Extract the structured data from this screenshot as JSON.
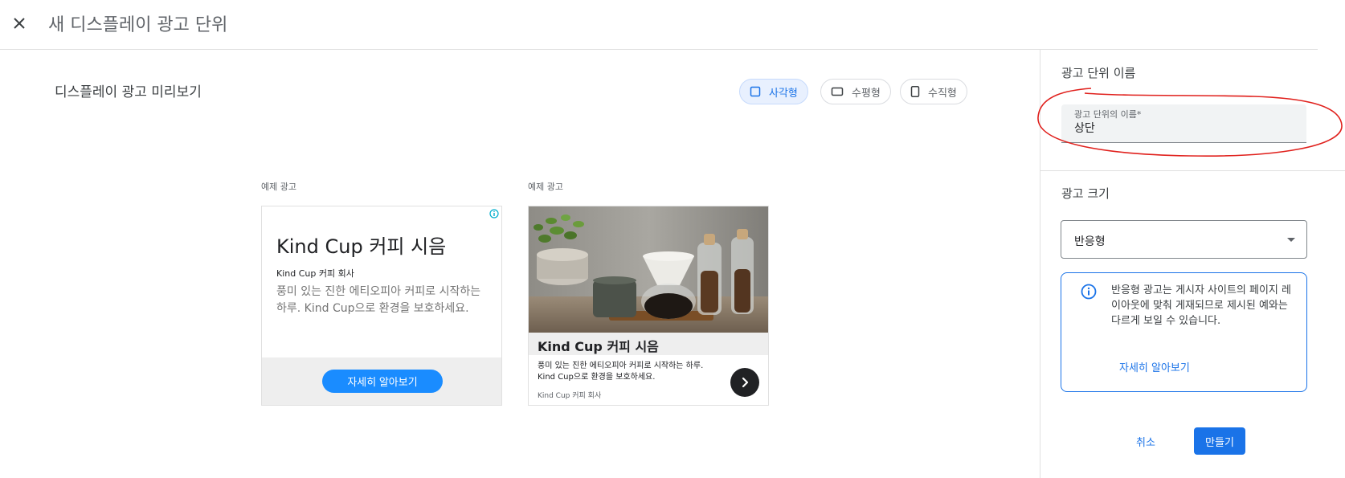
{
  "header": {
    "title": "새 디스플레이 광고 단위",
    "close_icon": "close-icon"
  },
  "preview": {
    "title": "디스플레이 광고 미리보기",
    "shapes": [
      {
        "label": "사각형",
        "icon": "square-icon",
        "selected": true
      },
      {
        "label": "수평형",
        "icon": "horizontal-rect-icon",
        "selected": false
      },
      {
        "label": "수직형",
        "icon": "vertical-rect-icon",
        "selected": false
      }
    ],
    "ads": [
      {
        "label": "예제 광고",
        "title": "Kind Cup 커피 시음",
        "company": "Kind Cup 커피 회사",
        "description": "풍미 있는 진한 에티오피아 커피로 시작하는 하루. Kind Cup으로 환경을 보호하세요.",
        "cta": "자세히 알아보기",
        "info_icon": "adchoices-info-icon"
      },
      {
        "label": "예제 광고",
        "title": "Kind Cup 커피 시음",
        "description": "풍미 있는 진한 에티오피아 커피로 시작하는 하루. Kind Cup으로 환경을 보호하세요.",
        "company": "Kind Cup 커피 회사",
        "arrow_icon": "chevron-right-icon"
      }
    ]
  },
  "sidepanel": {
    "name_section_title": "광고 단위 이름",
    "name_field_label": "광고 단위의 이름*",
    "name_field_value": "상단",
    "size_section_title": "광고 크기",
    "size_select_value": "반응형",
    "info_text": "반응형 광고는 게시자 사이트의 페이지 레이아웃에 맞춰 게재되므로 제시된 예와는 다르게 보일 수 있습니다.",
    "info_link": "자세히 알아보기",
    "cancel_label": "취소",
    "create_label": "만들기"
  },
  "colors": {
    "accent": "#1a73e8",
    "cta": "#1a8cff",
    "annotation": "#e0201c"
  }
}
